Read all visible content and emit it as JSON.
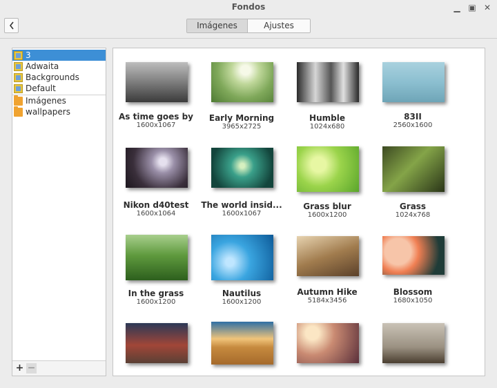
{
  "window": {
    "title": "Fondos",
    "controls": {
      "minimize_icon": "minimize-icon",
      "maximize_icon": "maximize-icon",
      "close_icon": "close-icon"
    }
  },
  "toolbar": {
    "back_icon": "chevron-left-icon",
    "tabs": [
      {
        "label": "Imágenes",
        "active": true
      },
      {
        "label": "Ajustes",
        "active": false
      }
    ]
  },
  "sidebar": {
    "items": [
      {
        "label": "3",
        "icon": "wallpaper-set-icon",
        "selected": true
      },
      {
        "label": "Adwaita",
        "icon": "wallpaper-set-icon",
        "selected": false
      },
      {
        "label": "Backgrounds",
        "icon": "wallpaper-set-icon",
        "selected": false
      },
      {
        "label": "Default",
        "icon": "wallpaper-set-icon",
        "selected": false
      },
      {
        "label": "Imágenes",
        "icon": "folder-icon",
        "selected": false
      },
      {
        "label": "wallpapers",
        "icon": "folder-icon",
        "selected": false
      }
    ],
    "add_label": "+",
    "remove_label": "−"
  },
  "wallpapers": [
    {
      "name": "As time goes by",
      "size": "1600x1067"
    },
    {
      "name": "Early Morning",
      "size": "3965x2725"
    },
    {
      "name": "Humble",
      "size": "1024x680"
    },
    {
      "name": "83II",
      "size": "2560x1600"
    },
    {
      "name": "Nikon d40test",
      "size": "1600x1064"
    },
    {
      "name": "The world insid...",
      "size": "1600x1067"
    },
    {
      "name": "Grass blur",
      "size": "1600x1200"
    },
    {
      "name": "Grass",
      "size": "1024x768"
    },
    {
      "name": "In the grass",
      "size": "1600x1200"
    },
    {
      "name": "Nautilus",
      "size": "1600x1200"
    },
    {
      "name": "Autumn Hike",
      "size": "5184x3456"
    },
    {
      "name": "Blossom",
      "size": "1680x1050"
    }
  ]
}
